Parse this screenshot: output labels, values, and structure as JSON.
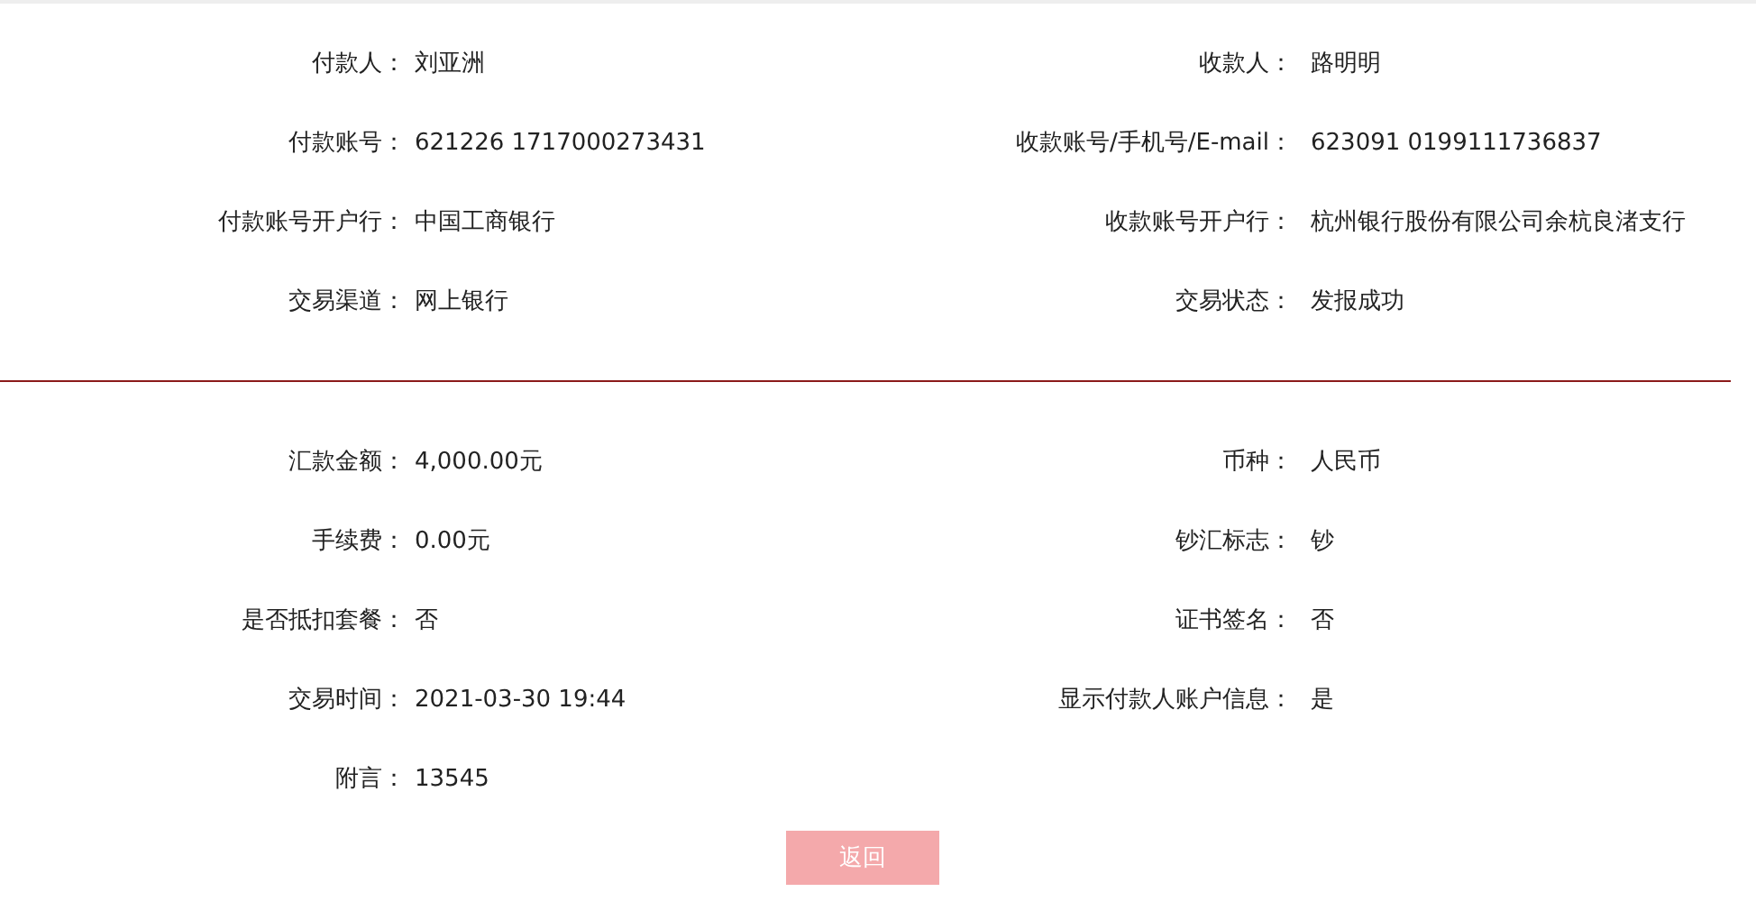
{
  "sections": [
    {
      "fields": [
        {
          "label": "付款人：",
          "value": "刘亚洲"
        },
        {
          "label": "收款人：",
          "value": "路明明"
        },
        {
          "label": "付款账号：",
          "value": "621226 1717000273431"
        },
        {
          "label": "收款账号/手机号/E-mail：",
          "value": "623091 0199111736837"
        },
        {
          "label": "付款账号开户行：",
          "value": "中国工商银行"
        },
        {
          "label": "收款账号开户行：",
          "value": "杭州银行股份有限公司余杭良渚支行"
        },
        {
          "label": "交易渠道：",
          "value": "网上银行"
        },
        {
          "label": "交易状态：",
          "value": "发报成功"
        }
      ]
    },
    {
      "fields": [
        {
          "label": "汇款金额：",
          "value": "4,000.00元"
        },
        {
          "label": "币种：",
          "value": "人民币"
        },
        {
          "label": "手续费：",
          "value": "0.00元"
        },
        {
          "label": "钞汇标志：",
          "value": "钞"
        },
        {
          "label": "是否抵扣套餐：",
          "value": "否"
        },
        {
          "label": "证书签名：",
          "value": "否"
        },
        {
          "label": "交易时间：",
          "value": "2021-03-30 19:44"
        },
        {
          "label": "显示付款人账户信息：",
          "value": "是"
        },
        {
          "label": "附言：",
          "value": "13545"
        }
      ]
    }
  ],
  "back_button": {
    "label": "返回"
  }
}
